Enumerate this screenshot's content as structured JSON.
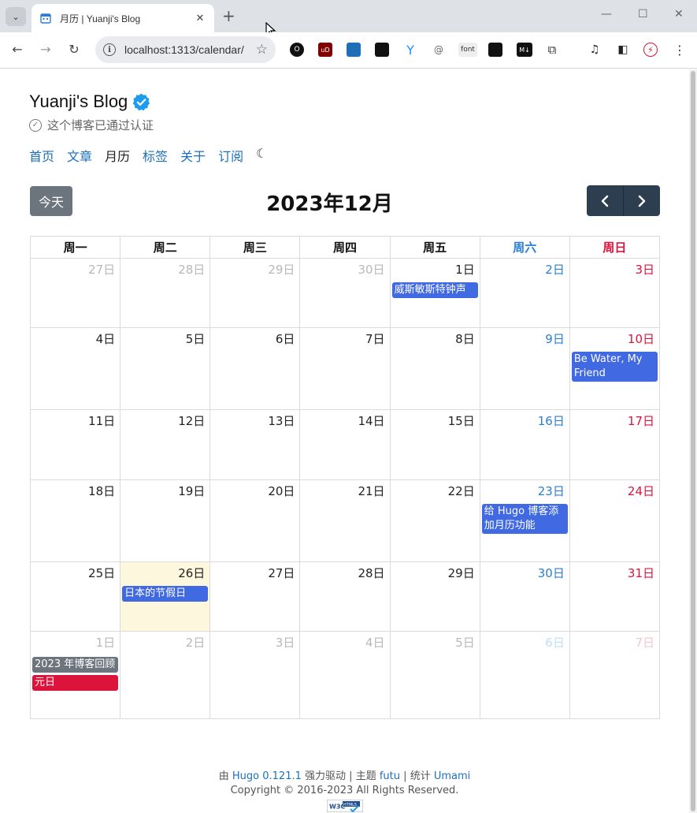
{
  "browser": {
    "tab_title": "月历 | Yuanji's Blog",
    "url": "localhost:1313/calendar/",
    "extensions": [
      "O",
      "uD",
      "",
      "",
      "",
      "",
      "font",
      "",
      "M↓",
      "",
      "",
      "",
      ""
    ]
  },
  "site": {
    "title": "Yuanji's Blog",
    "subtitle": "这个博客已通过认证",
    "nav": {
      "home": "首页",
      "posts": "文章",
      "calendar": "月历",
      "tags": "标签",
      "about": "关于",
      "subscribe": "订阅",
      "theme_icon": "☾"
    }
  },
  "calendar": {
    "today_label": "今天",
    "month_title": "2023年12月",
    "prev_icon": "‹",
    "next_icon": "›",
    "weekdays": [
      "周一",
      "周二",
      "周三",
      "周四",
      "周五",
      "周六",
      "周日"
    ],
    "weeks": [
      [
        {
          "d": "27日",
          "other": true
        },
        {
          "d": "28日",
          "other": true
        },
        {
          "d": "29日",
          "other": true
        },
        {
          "d": "30日",
          "other": true
        },
        {
          "d": "1日",
          "events": [
            {
              "title": "威斯敏斯特钟声",
              "kind": "post"
            }
          ]
        },
        {
          "d": "2日"
        },
        {
          "d": "3日"
        }
      ],
      [
        {
          "d": "4日"
        },
        {
          "d": "5日"
        },
        {
          "d": "6日"
        },
        {
          "d": "7日"
        },
        {
          "d": "8日"
        },
        {
          "d": "9日"
        },
        {
          "d": "10日",
          "events": [
            {
              "title": "Be Water, My Friend",
              "kind": "post"
            }
          ]
        }
      ],
      [
        {
          "d": "11日"
        },
        {
          "d": "12日"
        },
        {
          "d": "13日"
        },
        {
          "d": "14日"
        },
        {
          "d": "15日"
        },
        {
          "d": "16日"
        },
        {
          "d": "17日"
        }
      ],
      [
        {
          "d": "18日"
        },
        {
          "d": "19日"
        },
        {
          "d": "20日"
        },
        {
          "d": "21日"
        },
        {
          "d": "22日"
        },
        {
          "d": "23日",
          "events": [
            {
              "title": "给 Hugo 博客添加月历功能",
              "kind": "post"
            }
          ]
        },
        {
          "d": "24日"
        }
      ],
      [
        {
          "d": "25日"
        },
        {
          "d": "26日",
          "today": true,
          "events": [
            {
              "title": "日本的节假日",
              "kind": "post"
            }
          ]
        },
        {
          "d": "27日"
        },
        {
          "d": "28日"
        },
        {
          "d": "29日"
        },
        {
          "d": "30日"
        },
        {
          "d": "31日"
        }
      ],
      [
        {
          "d": "1日",
          "other": true,
          "events": [
            {
              "title": "2023 年博客回顾",
              "kind": "gray"
            },
            {
              "title": "元日",
              "kind": "red"
            }
          ]
        },
        {
          "d": "2日",
          "other": true
        },
        {
          "d": "3日",
          "other": true
        },
        {
          "d": "4日",
          "other": true
        },
        {
          "d": "5日",
          "other": true
        },
        {
          "d": "6日",
          "other": true
        },
        {
          "d": "7日",
          "other": true
        }
      ]
    ]
  },
  "footer": {
    "by": "由",
    "hugo": "Hugo 0.121.1",
    "powered": "强力驱动",
    "sep1": "|",
    "theme_label": "主题",
    "theme": "futu",
    "sep2": "|",
    "stats_label": "统计",
    "stats": "Umami",
    "copyright": "Copyright © 2016-2023 All Rights Reserved."
  },
  "colors": {
    "link": "#1e6fb8",
    "event": "#4169e1",
    "saturday": "#2a7fd4",
    "sunday": "#dc143c",
    "today_bg": "#fdf7dd",
    "nav_buttons": "#2c3e50"
  }
}
